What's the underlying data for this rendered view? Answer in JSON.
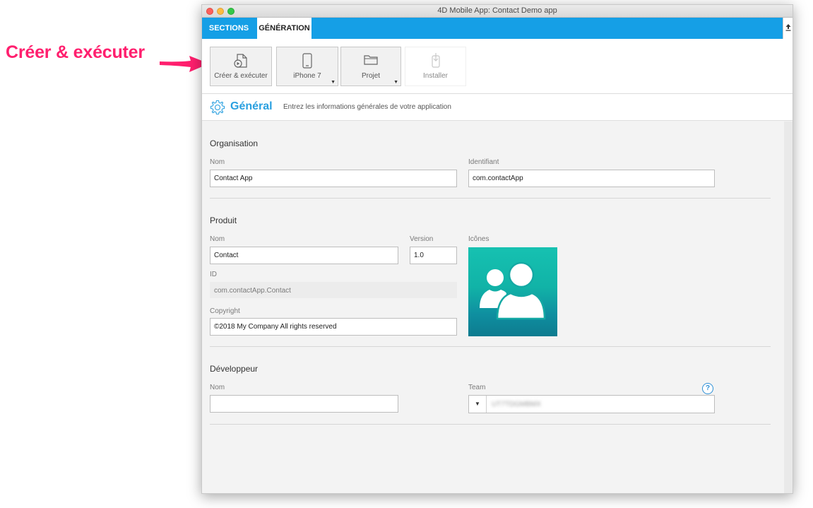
{
  "annotation": {
    "label": "Créer & exécuter",
    "color": "#ff1f6e"
  },
  "window": {
    "title": "4D Mobile App: Contact Demo app"
  },
  "tabs": [
    {
      "label": "SECTIONS",
      "active": false
    },
    {
      "label": "GÉNÉRATION",
      "active": true
    }
  ],
  "toolbar": {
    "build_run": {
      "label": "Créer & exécuter",
      "icon": "build-run-icon"
    },
    "device": {
      "label": "iPhone 7",
      "icon": "iphone-icon",
      "has_menu": true
    },
    "project": {
      "label": "Projet",
      "icon": "folder-icon",
      "has_menu": true
    },
    "install": {
      "label": "Installer",
      "icon": "install-icon",
      "enabled": false
    }
  },
  "section": {
    "title": "Général",
    "description": "Entrez les informations générales de votre application",
    "icon": "gear-icon"
  },
  "organisation": {
    "heading": "Organisation",
    "name_label": "Nom",
    "name_value": "Contact App",
    "identifier_label": "Identifiant",
    "identifier_value": "com.contactApp"
  },
  "product": {
    "heading": "Produit",
    "name_label": "Nom",
    "name_value": "Contact",
    "version_label": "Version",
    "version_value": "1.0",
    "icons_label": "Icônes",
    "id_label": "ID",
    "id_value": "com.contactApp.Contact",
    "copyright_label": "Copyright",
    "copyright_value": "©2018 My Company All rights reserved"
  },
  "developer": {
    "heading": "Développeur",
    "name_label": "Nom",
    "name_value": "",
    "team_label": "Team",
    "team_value": "UT7TDGMBMX",
    "help_symbol": "?"
  },
  "colors": {
    "accent": "#159fe6",
    "title_blue": "#2aa0e0",
    "icon_teal": "#16c1b1"
  }
}
